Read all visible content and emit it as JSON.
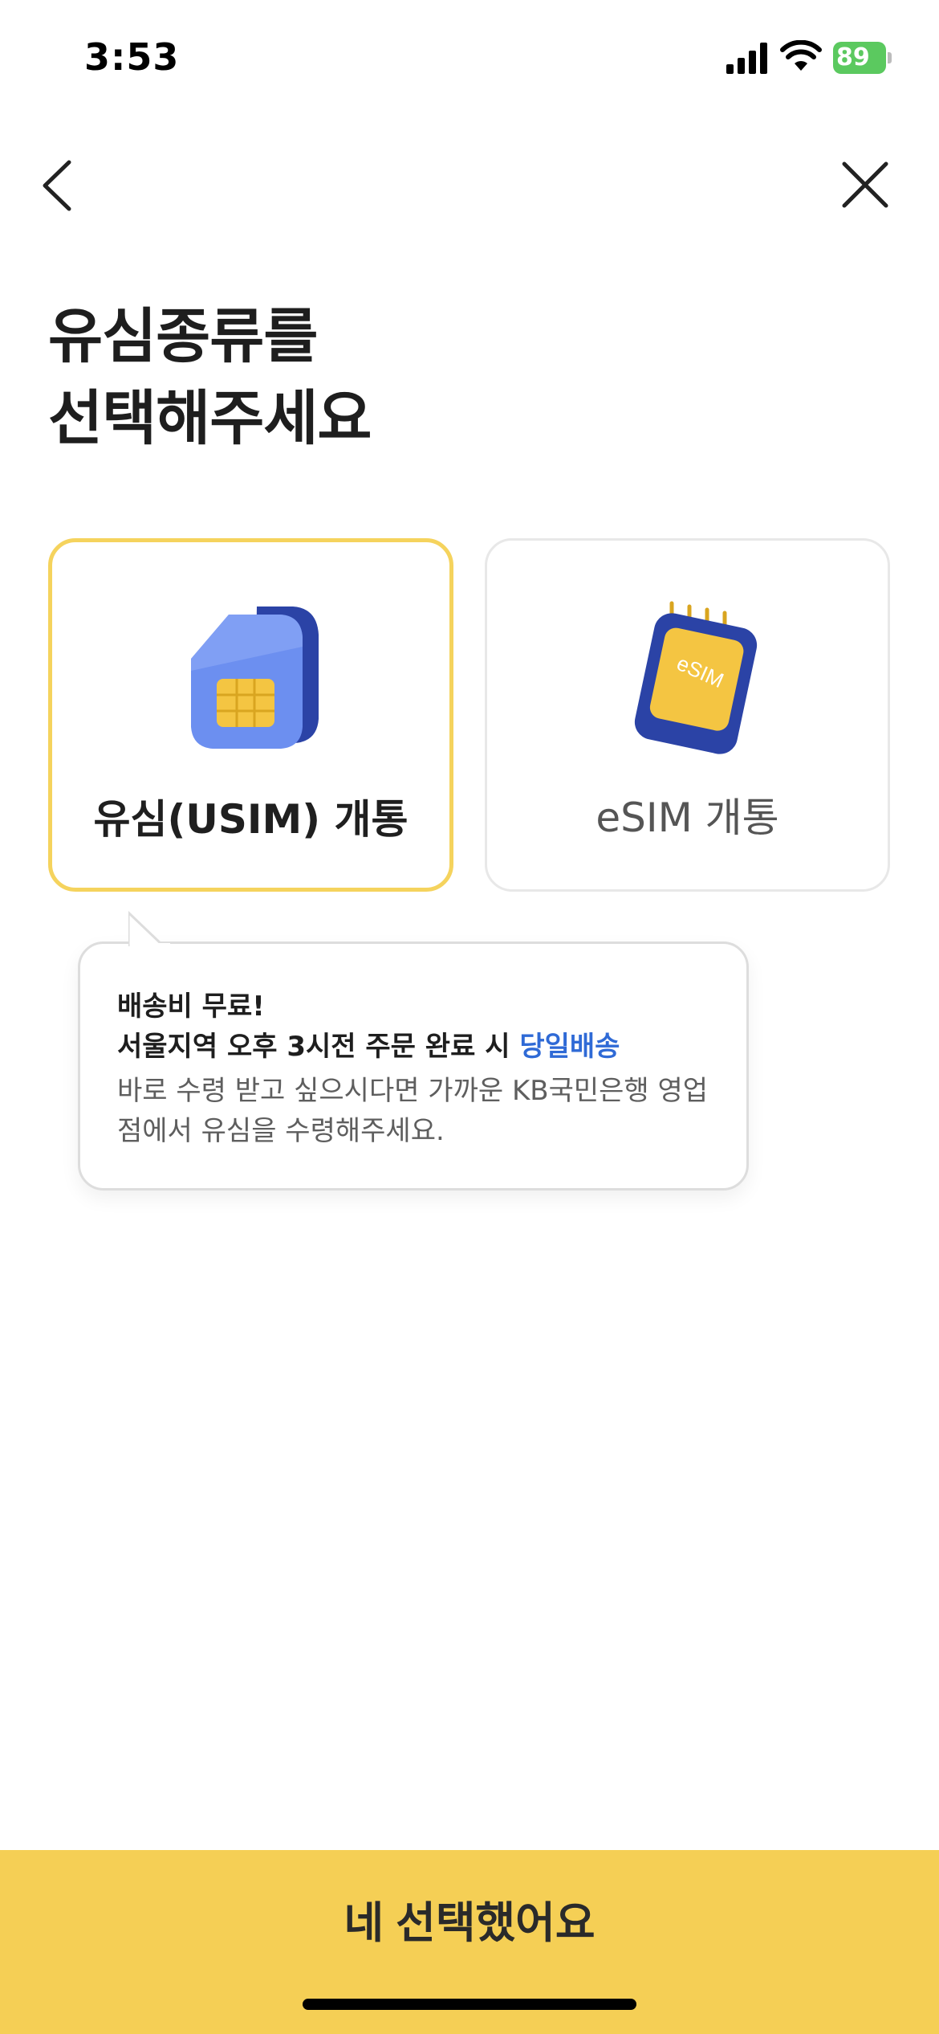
{
  "status_bar": {
    "time": "3:53",
    "battery": "89",
    "icons": [
      "signal-icon",
      "wifi-icon",
      "battery-icon"
    ]
  },
  "nav": {
    "back_icon": "chevron-left-icon",
    "close_icon": "close-icon"
  },
  "title": {
    "line1": "유심종류를",
    "line2": "선택해주세요"
  },
  "options": [
    {
      "label": "유심(USIM) 개통",
      "selected": true,
      "icon": "usim-card-icon"
    },
    {
      "label": "eSIM 개통",
      "selected": false,
      "icon": "esim-chip-icon",
      "icon_text": "eSIM"
    }
  ],
  "tooltip": {
    "line1": "배송비 무료!",
    "line2_prefix": "서울지역 오후 3시전 주문 완료 시 ",
    "line2_highlight": "당일배송",
    "description": "바로 수령 받고 싶으시다면 가까운 KB국민은행 영업점에서 유심을 수령해주세요."
  },
  "confirm_button": {
    "label": "네 선택했어요"
  },
  "colors": {
    "accent_yellow": "#f5cf55",
    "selected_border": "#f5d35d",
    "highlight_blue": "#2f6ad6",
    "battery_green": "#5bc95f"
  }
}
